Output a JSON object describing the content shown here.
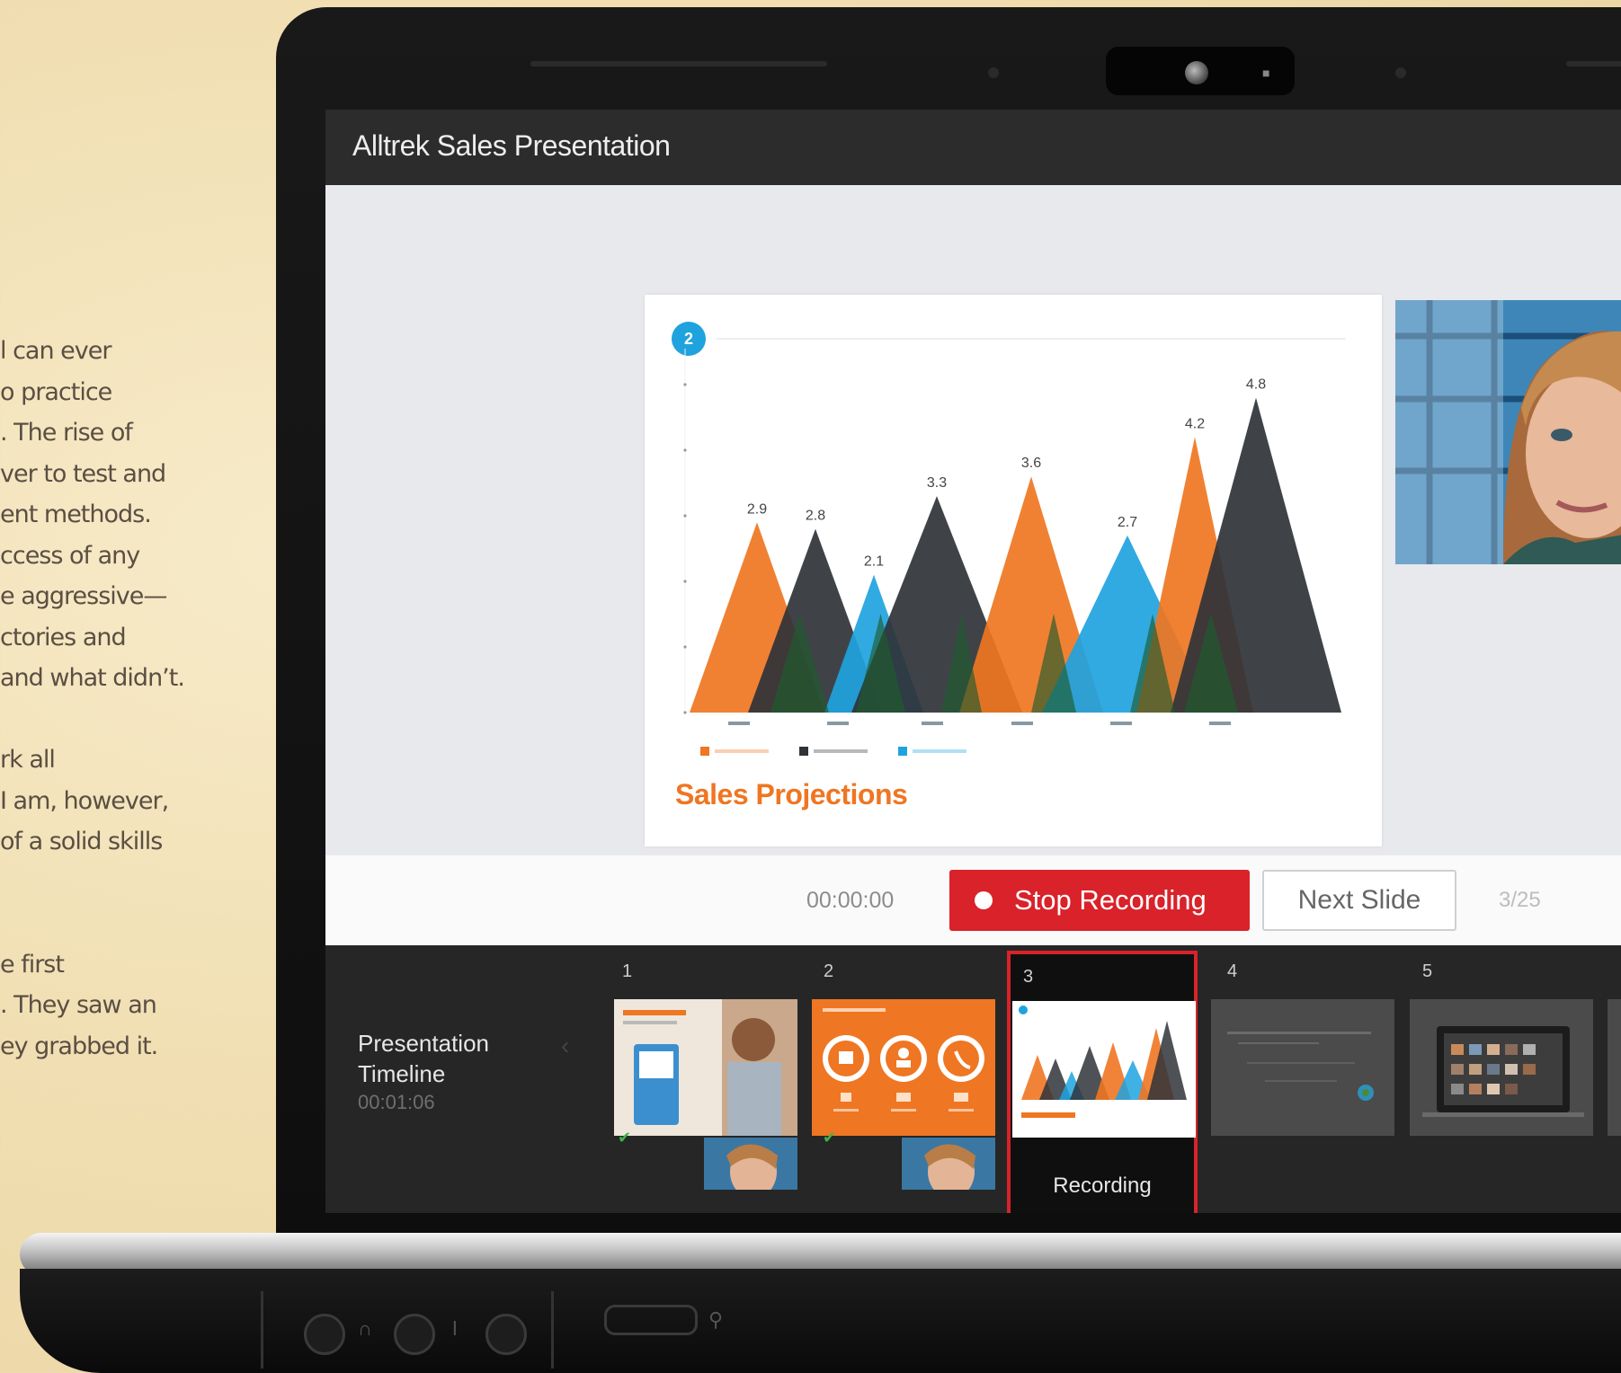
{
  "page_text": {
    "lines": [
      "l can ever",
      "o practice",
      ". The rise of",
      "ver to test and",
      "ent methods.",
      "ccess of any",
      "e aggressive—",
      "ctories and",
      "and what didn’t.",
      "",
      "rk all",
      "I am, however,",
      "of a solid skills",
      "",
      "",
      "e first",
      ". They saw an",
      "ey grabbed it."
    ]
  },
  "app": {
    "title": "Alltrek Sales Presentation"
  },
  "slide": {
    "badge": "2",
    "title": "Sales Projections"
  },
  "chart_data": {
    "type": "area",
    "note": "Overlapping triangular peaks",
    "series": [
      {
        "color": "#ef7622",
        "peaks": [
          2.9,
          3.6,
          4.2
        ]
      },
      {
        "color": "#2f3338",
        "peaks": [
          2.8,
          3.3,
          4.8
        ]
      },
      {
        "color": "#1fa3df",
        "peaks": [
          2.1,
          2.7
        ]
      }
    ],
    "data_labels": [
      "2.9",
      "2.8",
      "2.1",
      "3.3",
      "3.6",
      "2.7",
      "4.2",
      "4.8"
    ],
    "ylim": [
      0,
      5
    ],
    "legend_colors": [
      "#ef7622",
      "#2f3338",
      "#1fa3df"
    ],
    "legend_position": "bottom-left"
  },
  "controls": {
    "timer": "00:00:00",
    "stop_label": "Stop Recording",
    "next_label": "Next Slide",
    "page_count": "3/25"
  },
  "timeline": {
    "title": "Presentation Timeline",
    "elapsed": "00:01:06",
    "thumbnails": [
      {
        "num": "1",
        "done": true
      },
      {
        "num": "2",
        "done": true
      },
      {
        "num": "3",
        "status": "Recording"
      },
      {
        "num": "4"
      },
      {
        "num": "5"
      }
    ]
  },
  "colors": {
    "accent_red": "#d9222a",
    "orange": "#ef7622",
    "blue": "#1fa3df",
    "dark": "#2f3338",
    "green": "#1f5a2e"
  }
}
